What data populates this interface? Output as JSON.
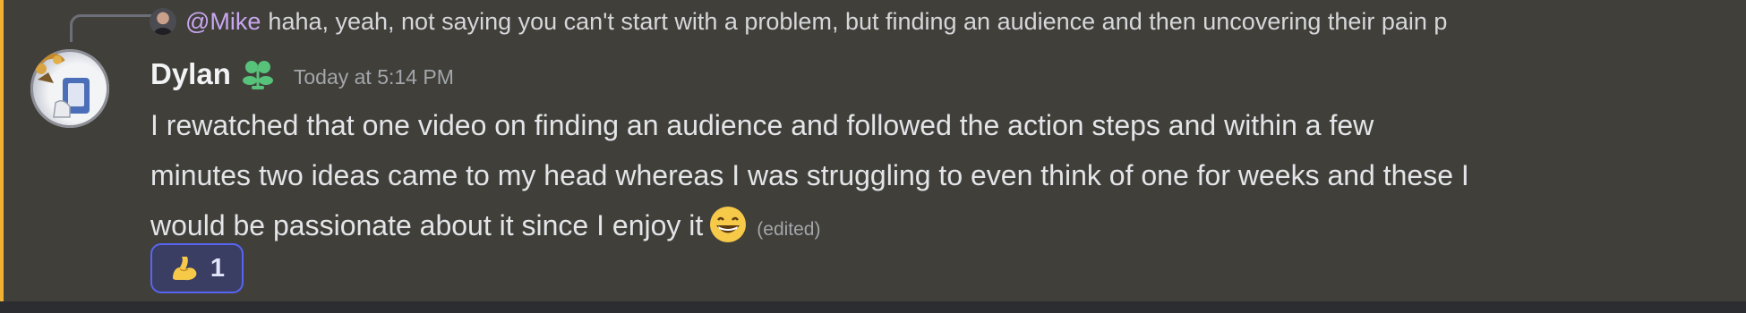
{
  "reply": {
    "author": "@Mike",
    "text": "haha, yeah, not saying you can't start with a problem, but finding an audience and then uncovering their pain p"
  },
  "message": {
    "username": "Dylan",
    "timestamp": "Today at 5:14 PM",
    "lines": [
      "I rewatched that one video on finding an audience and followed the action steps and within a few",
      "minutes two ideas came to my head whereas I was struggling to even think of one for weeks and these I",
      "would be passionate about it since I enjoy it"
    ],
    "edited_label": "(edited)",
    "emoji": "grinning-face-with-smiling-eyes"
  },
  "reaction": {
    "emoji": "flexed-biceps",
    "count": "1"
  },
  "colors": {
    "accent_bar": "#f0b232",
    "reply_author": "#c9a7f0",
    "reaction_border": "#5865f2",
    "role_icon": "#57c27a"
  }
}
